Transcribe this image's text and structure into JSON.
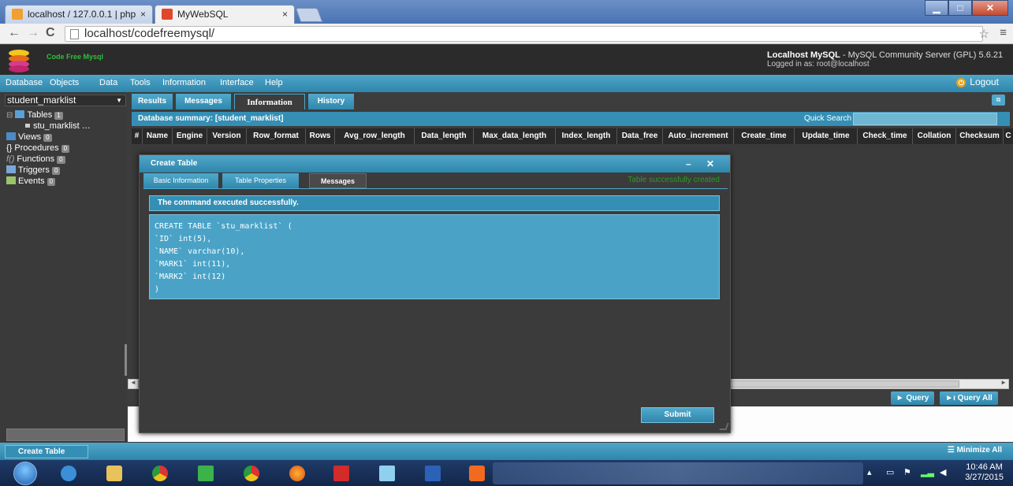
{
  "browser": {
    "tabs": [
      {
        "title": "localhost / 127.0.0.1 | php",
        "close": "×"
      },
      {
        "title": "MyWebSQL",
        "close": "×"
      }
    ],
    "window_buttons": {
      "minimize": "▁",
      "maximize": "□",
      "close": "✕"
    },
    "nav": {
      "back": "←",
      "forward": "→",
      "reload": "C"
    },
    "url": "localhost/codefreemysql/",
    "bookmark_star": "☆",
    "menu": "≡"
  },
  "app": {
    "logo_text": "Code Free Mysql",
    "server_title": "Localhost MySQL",
    "server_version": " - MySQL Community Server (GPL) 5.6.21",
    "logged_in": "Logged in as: root@localhost",
    "menu": [
      "Database",
      "Objects",
      "Data",
      "Tools",
      "Information",
      "Interface",
      "Help"
    ],
    "logout": "Logout"
  },
  "sidebar": {
    "db_selected": "student_marklist",
    "tree": [
      {
        "label": "Tables",
        "count": "1",
        "prefix": "⊟"
      },
      {
        "label": "stu_marklist",
        "suffix": "…"
      },
      {
        "label": "Views",
        "count": "0"
      },
      {
        "label": "Procedures",
        "count": "0",
        "prefix": "{}"
      },
      {
        "label": "Functions",
        "count": "0",
        "prefix": "f()"
      },
      {
        "label": "Triggers",
        "count": "0"
      },
      {
        "label": "Events",
        "count": "0"
      }
    ]
  },
  "main": {
    "tabs": [
      "Results",
      "Messages",
      "Information",
      "History"
    ],
    "active_tab": "Information",
    "summary_title": "Database summary: [student_marklist]",
    "quick_search_label": "Quick Search",
    "columns": [
      "#",
      "Name",
      "Engine",
      "Version",
      "Row_format",
      "Rows",
      "Avg_row_length",
      "Data_length",
      "Max_data_length",
      "Index_length",
      "Data_free",
      "Auto_increment",
      "Create_time",
      "Update_time",
      "Check_time",
      "Collation",
      "Checksum",
      "C"
    ],
    "query_button": "► Query",
    "query_all_button": "►ı Query All"
  },
  "dialog": {
    "title": "Create Table",
    "controls": "– ✕",
    "tabs": [
      "Basic Information",
      "Table Properties",
      "Messages"
    ],
    "active_tab": "Messages",
    "status_message": "Table successfully created",
    "success_text": "The command executed successfully.",
    "sql": [
      "CREATE TABLE `stu_marklist` (",
      "`ID` int(5),",
      "`NAME` varchar(10),",
      "`MARK1` int(11),",
      "`MARK2` int(12)",
      ")"
    ],
    "submit": "Submit"
  },
  "statusbar": {
    "create_table": "Create Table",
    "minimize_all": "☰ Minimize All"
  },
  "taskbar": {
    "time": "10:46 AM",
    "date": "3/27/2015",
    "tray": "▴"
  },
  "colors": {
    "accent": "#2e86ac",
    "header_bg": "#2b2b2b",
    "success_green": "#2b9b2b"
  }
}
